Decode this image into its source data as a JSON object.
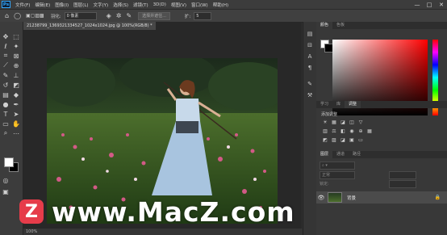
{
  "app": {
    "logo": "Ps"
  },
  "menubar": {
    "items": [
      "文件(F)",
      "编辑(E)",
      "图像(I)",
      "图层(L)",
      "文字(Y)",
      "选择(S)",
      "滤镜(T)",
      "3D(D)",
      "视图(V)",
      "窗口(W)",
      "帮助(H)"
    ],
    "minimize": "—",
    "maximize": "□",
    "close": "✕"
  },
  "options": {
    "feather_label": "羽化:",
    "feather_value": "0 像素",
    "select_subject": "选择并遮住...",
    "expand_label": "扩:",
    "expand_value": "5"
  },
  "document": {
    "tab_title": "21238799_1369321334527_1024x1024.jpg @ 100%(RGB/8) *",
    "status": "100%"
  },
  "panels": {
    "color_tabs": [
      "颜色",
      "色板"
    ],
    "learn_tabs": [
      "学习",
      "库",
      "调整"
    ],
    "adjustments_label": "添加调整",
    "layers_tabs": [
      "图层",
      "通道",
      "路径"
    ],
    "blend_mode": "正常",
    "lock_label": "锁定:",
    "layer_name": "背景"
  },
  "colors": {
    "hue_red": "#ff0000",
    "accent": "#31a8ff"
  },
  "watermark": {
    "logo": "Z",
    "text": "www.MacZ.com"
  }
}
